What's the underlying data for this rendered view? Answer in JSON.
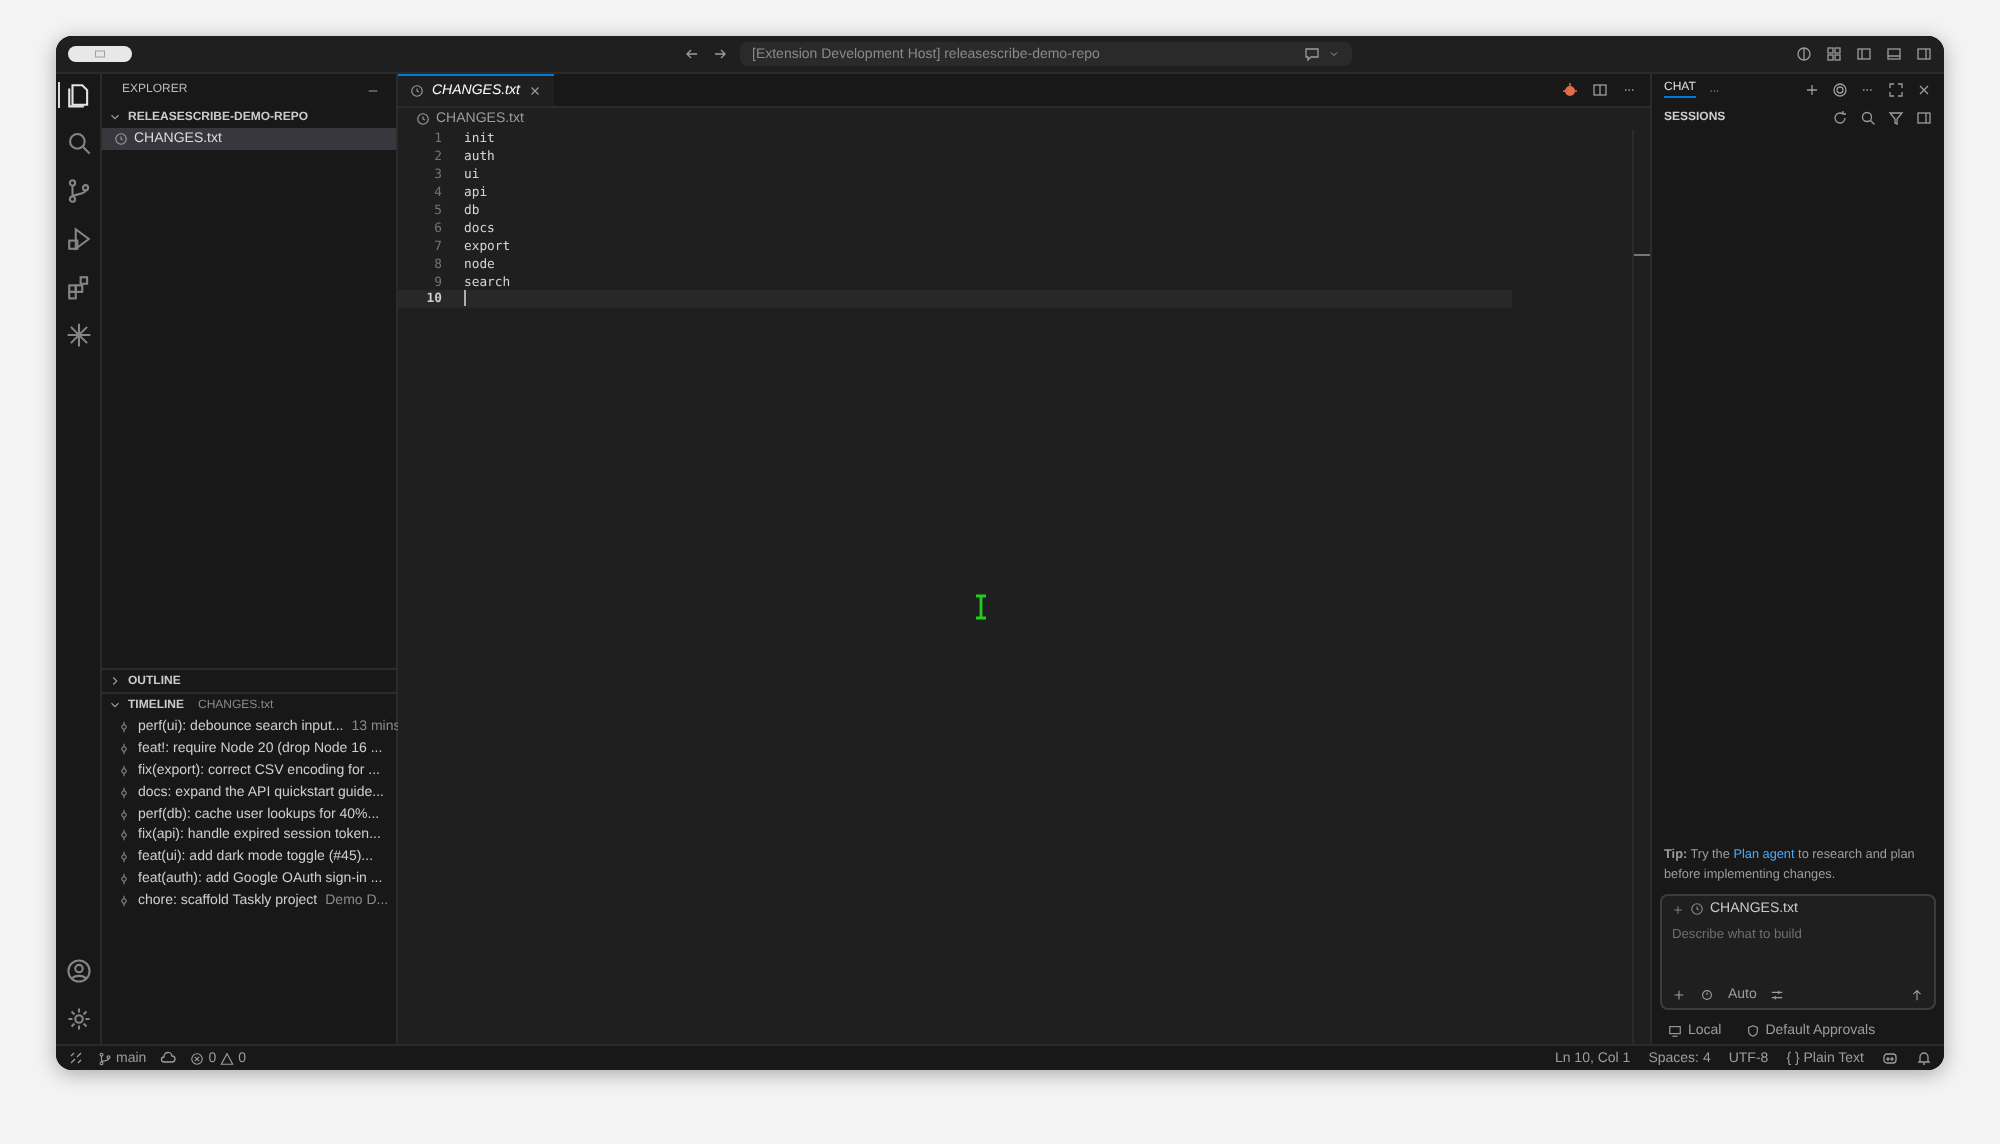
{
  "title_bar": {
    "title": "[Extension Development Host] releasescribe-demo-repo"
  },
  "activity_bar": {
    "items": [
      {
        "kind": "files",
        "selected": true
      },
      {
        "kind": "search",
        "selected": false
      },
      {
        "kind": "branch",
        "selected": false
      },
      {
        "kind": "debug",
        "selected": false
      },
      {
        "kind": "extensions",
        "selected": false
      },
      {
        "kind": "spark",
        "selected": false
      }
    ]
  },
  "sidebar": {
    "title": "EXPLORER",
    "folder": {
      "name": "RELEASESCRIBE-DEMO-REPO",
      "expanded": true,
      "files": [
        {
          "name": "CHANGES.txt",
          "selected": true
        }
      ]
    },
    "outline": {
      "label": "OUTLINE",
      "expanded": false
    },
    "timeline": {
      "label": "TIMELINE",
      "file": "CHANGES.txt",
      "expanded": true,
      "entries": [
        {
          "message": "perf(ui): debounce search input...",
          "meta": "13 mins"
        },
        {
          "message": "feat!: require Node 20 (drop Node 16 ..."
        },
        {
          "message": "fix(export): correct CSV encoding for ..."
        },
        {
          "message": "docs: expand the API quickstart guide..."
        },
        {
          "message": "perf(db): cache user lookups for 40%..."
        },
        {
          "message": "fix(api): handle expired session token..."
        },
        {
          "message": "feat(ui): add dark mode toggle (#45)..."
        },
        {
          "message": "feat(auth): add Google OAuth sign-in ..."
        },
        {
          "message": "chore: scaffold Taskly project",
          "meta": "Demo D..."
        }
      ]
    }
  },
  "editor": {
    "tab": {
      "label": "CHANGES.txt",
      "selected": true
    },
    "breadcrumb": "CHANGES.txt",
    "lines": [
      {
        "number": "1",
        "text": "init",
        "current": false
      },
      {
        "number": "2",
        "text": "auth",
        "current": false
      },
      {
        "number": "3",
        "text": "ui",
        "current": false
      },
      {
        "number": "4",
        "text": "api",
        "current": false
      },
      {
        "number": "5",
        "text": "db",
        "current": false
      },
      {
        "number": "6",
        "text": "docs",
        "current": false
      },
      {
        "number": "7",
        "text": "export",
        "current": false
      },
      {
        "number": "8",
        "text": "node",
        "current": false
      },
      {
        "number": "9",
        "text": "search",
        "current": false
      },
      {
        "number": "10",
        "current": true
      }
    ]
  },
  "chat": {
    "tab": "CHAT",
    "sessions": "SESSIONS",
    "tip": {
      "before": "**Tip:** Try the",
      "link": "Plan agent",
      "after": "to research and plan before implementing changes."
    },
    "context_file": "CHANGES.txt",
    "placeholder": "Describe what to build",
    "mode": "Auto",
    "target": "Local",
    "approvals": "Default Approvals"
  },
  "status_bar": {
    "branch": "main",
    "errors": "0",
    "warnings": "0",
    "position": "Ln 10, Col 1",
    "indent": "Spaces: 4",
    "encoding": "UTF-8",
    "language_icon": "{ }",
    "language": "Plain Text"
  }
}
